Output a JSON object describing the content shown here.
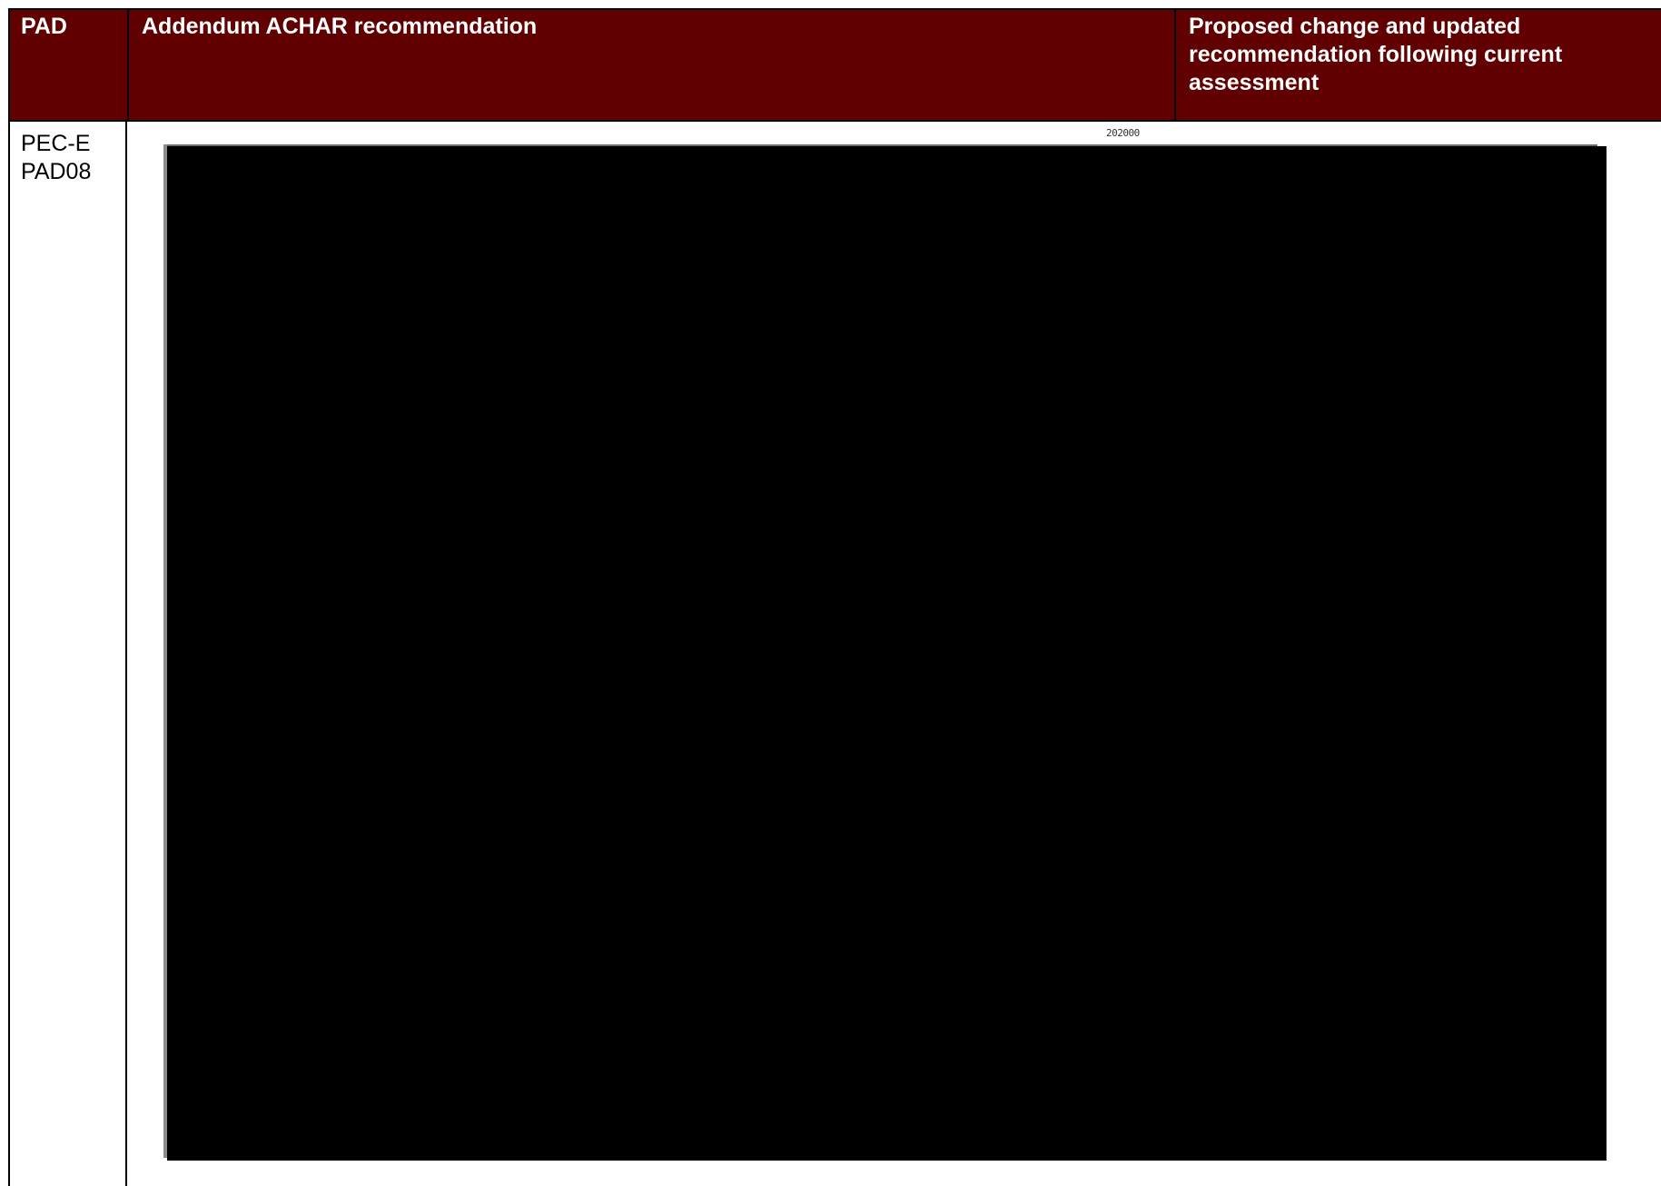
{
  "table": {
    "headers": {
      "pad": "PAD",
      "addendum": "Addendum  ACHAR recommendation",
      "proposed": "Proposed change and updated recommendation following current assessment"
    },
    "rows": [
      {
        "pad_line1": "PEC-E",
        "pad_line2": "PAD08",
        "map": {
          "coordinate_label": "202000"
        }
      }
    ]
  },
  "colors": {
    "header_background": "#600000",
    "header_text": "#ffffff",
    "map_redacted": "#000000"
  }
}
